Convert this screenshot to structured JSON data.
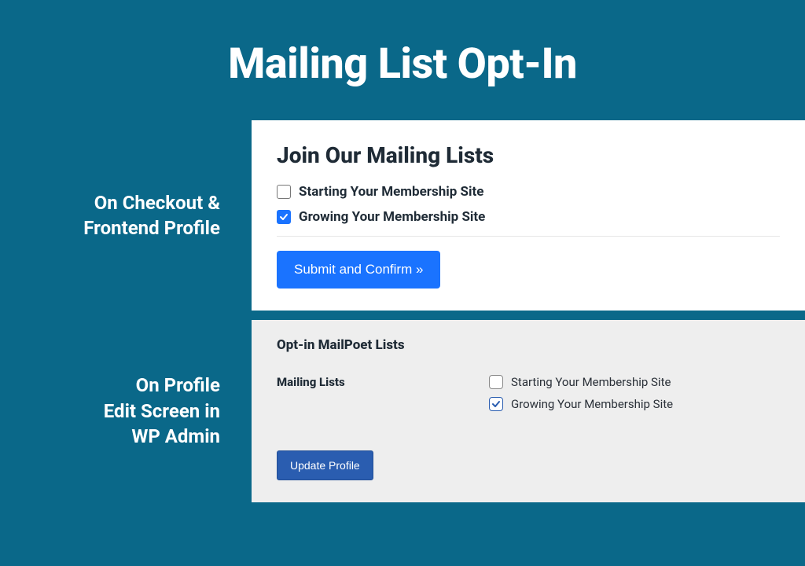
{
  "title": "Mailing List Opt-In",
  "section1": {
    "caption_line1": "On Checkout &",
    "caption_line2": "Frontend Profile",
    "heading": "Join Our Mailing Lists",
    "options": [
      {
        "label": "Starting Your Membership Site",
        "checked": false
      },
      {
        "label": "Growing Your Membership Site",
        "checked": true
      }
    ],
    "button": "Submit and Confirm »"
  },
  "section2": {
    "caption_line1": "On Profile",
    "caption_line2": "Edit Screen in",
    "caption_line3": "WP Admin",
    "heading": "Opt-in MailPoet Lists",
    "field_label": "Mailing Lists",
    "options": [
      {
        "label": "Starting Your Membership Site",
        "checked": false
      },
      {
        "label": "Growing Your Membership Site",
        "checked": true
      }
    ],
    "button": "Update Profile"
  }
}
